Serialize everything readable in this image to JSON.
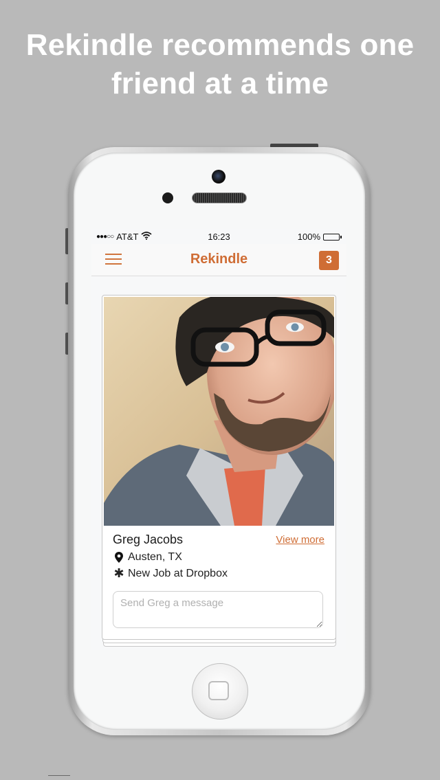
{
  "headline": {
    "line1": "Rekindle recommends one",
    "line2": "friend at a time"
  },
  "status_bar": {
    "signal": "●●●○○",
    "carrier": "AT&T",
    "time": "16:23",
    "battery": "100%"
  },
  "nav": {
    "title": "Rekindle",
    "badge_count": "3",
    "menu_icon": "hamburger-icon"
  },
  "card": {
    "name": "Greg Jacobs",
    "view_more": "View more",
    "location": "Austen, TX",
    "update": "New Job at Dropbox",
    "message_placeholder": "Send Greg a message"
  },
  "colors": {
    "accent": "#cf6d35",
    "background": "#b9b9b9"
  }
}
